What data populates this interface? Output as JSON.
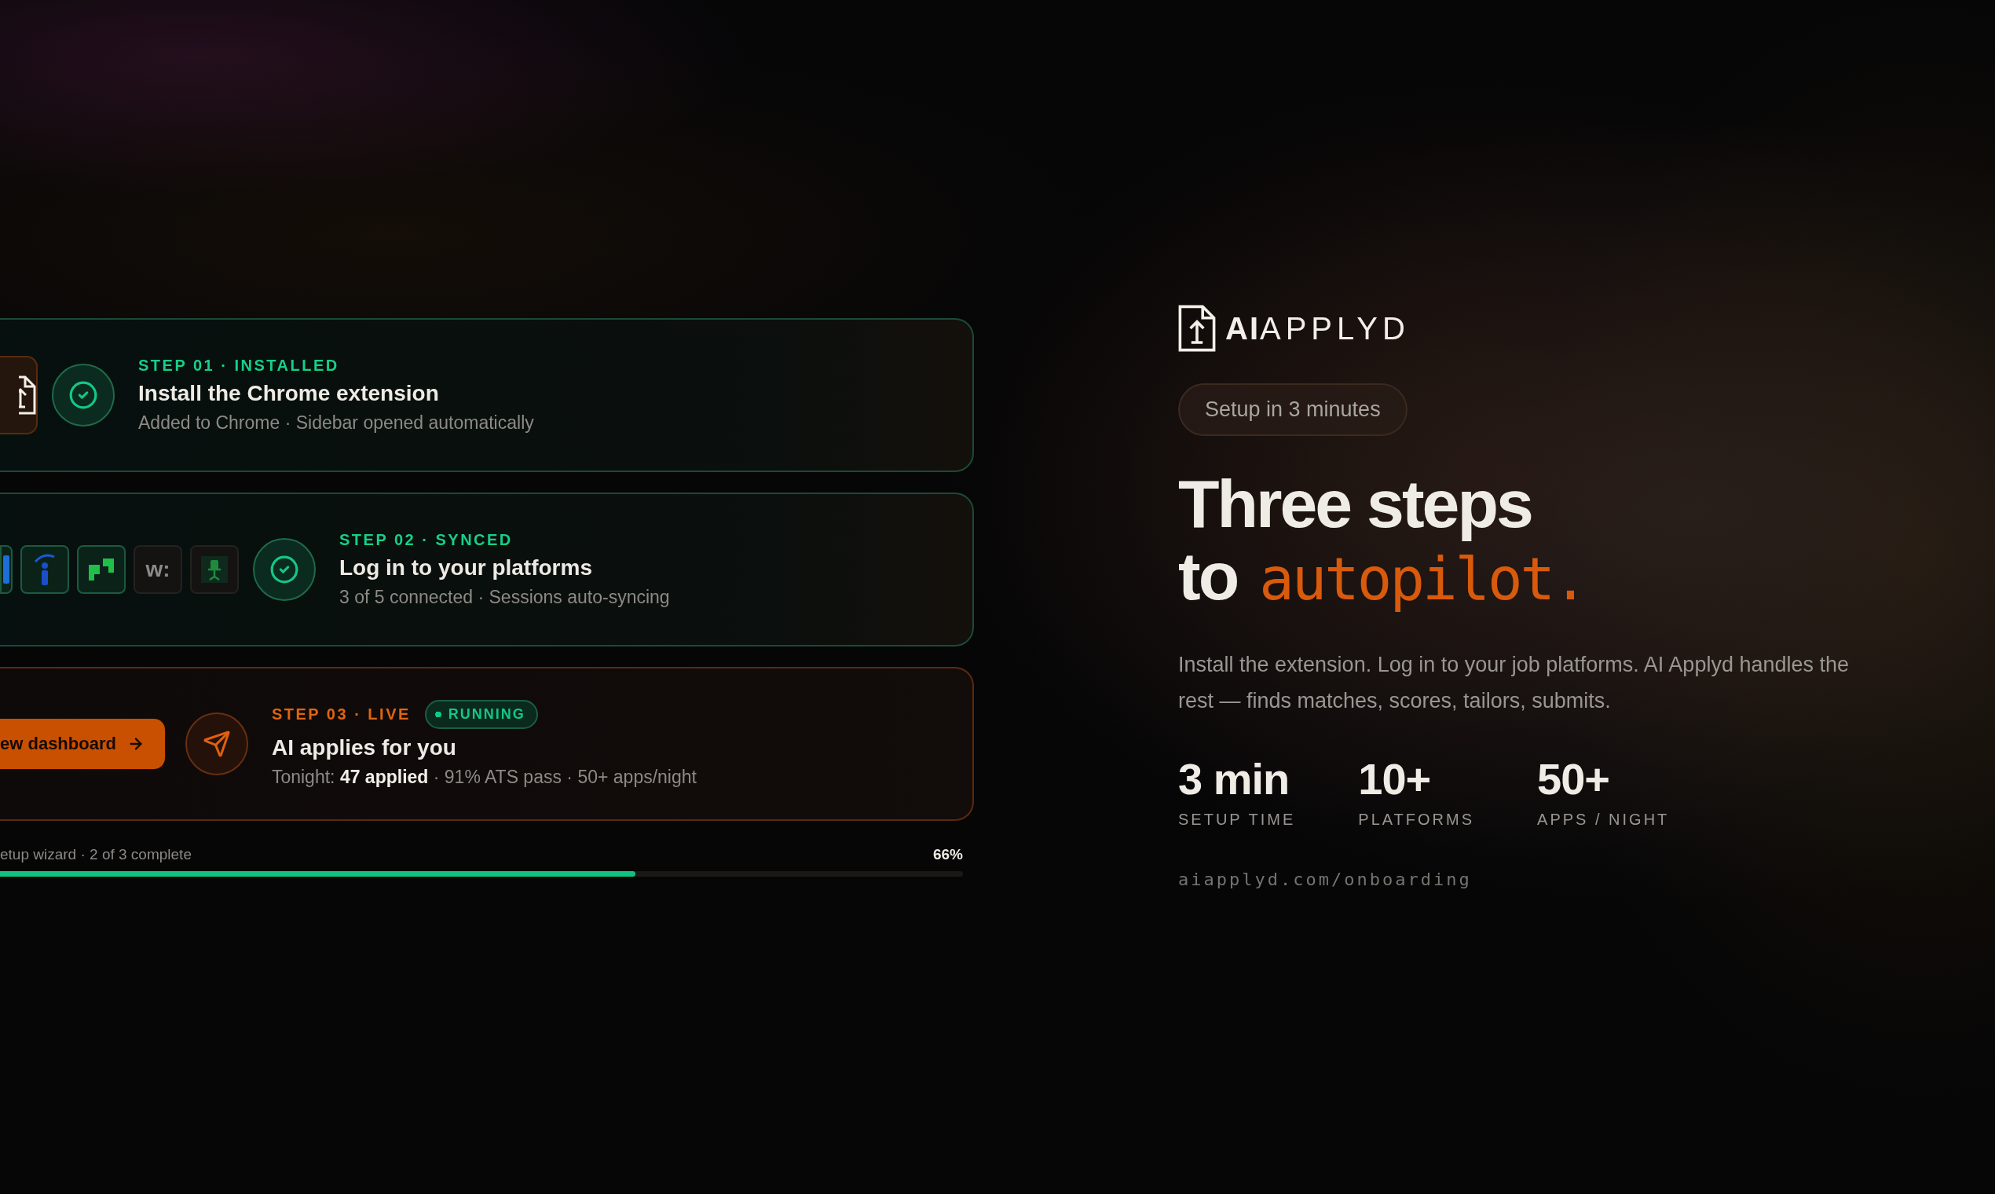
{
  "steps": [
    {
      "kind": "install",
      "live": false,
      "label": "STEP 01 · INSTALLED",
      "title": "Install the Chrome extension",
      "detail": "Added to Chrome · Sidebar opened automatically"
    },
    {
      "kind": "platforms",
      "live": false,
      "label": "STEP 02 · SYNCED",
      "title": "Log in to your platforms",
      "detail": "3 of 5 connected · Sessions auto-syncing",
      "platforms": [
        {
          "kind": "bar",
          "connected": true
        },
        {
          "kind": "letter-i",
          "connected": true
        },
        {
          "kind": "quote",
          "connected": true
        },
        {
          "kind": "wordmark",
          "text": "w:",
          "connected": false
        },
        {
          "kind": "chair",
          "connected": false
        }
      ]
    },
    {
      "kind": "action",
      "live": true,
      "label": "STEP 03 · LIVE",
      "badge": "RUNNING",
      "button": "ew dashboard",
      "title": "AI applies for you",
      "detail": "Tonight: **47 applied** · 91% ATS pass · 50+ apps/night"
    }
  ],
  "progress": {
    "label": "etup wizard · 2 of 3 complete",
    "reading": "66%",
    "level": 0.66
  },
  "brand": {
    "bold": "AI",
    "light": "APPLYD"
  },
  "badge": "Setup in 3 minutes",
  "headline": {
    "line1": "Three steps",
    "line2": "to",
    "accent": "autopilot."
  },
  "description": "Install the extension. Log in to your job platforms. AI Applyd handles the rest — finds matches, scores, tailors, submits.",
  "stats": [
    {
      "value": "3 min",
      "label": "SETUP TIME"
    },
    {
      "value": "10+",
      "label": "PLATFORMS"
    },
    {
      "value": "50+",
      "label": "APPS / NIGHT"
    }
  ],
  "url": "aiapplyd.com/onboarding"
}
